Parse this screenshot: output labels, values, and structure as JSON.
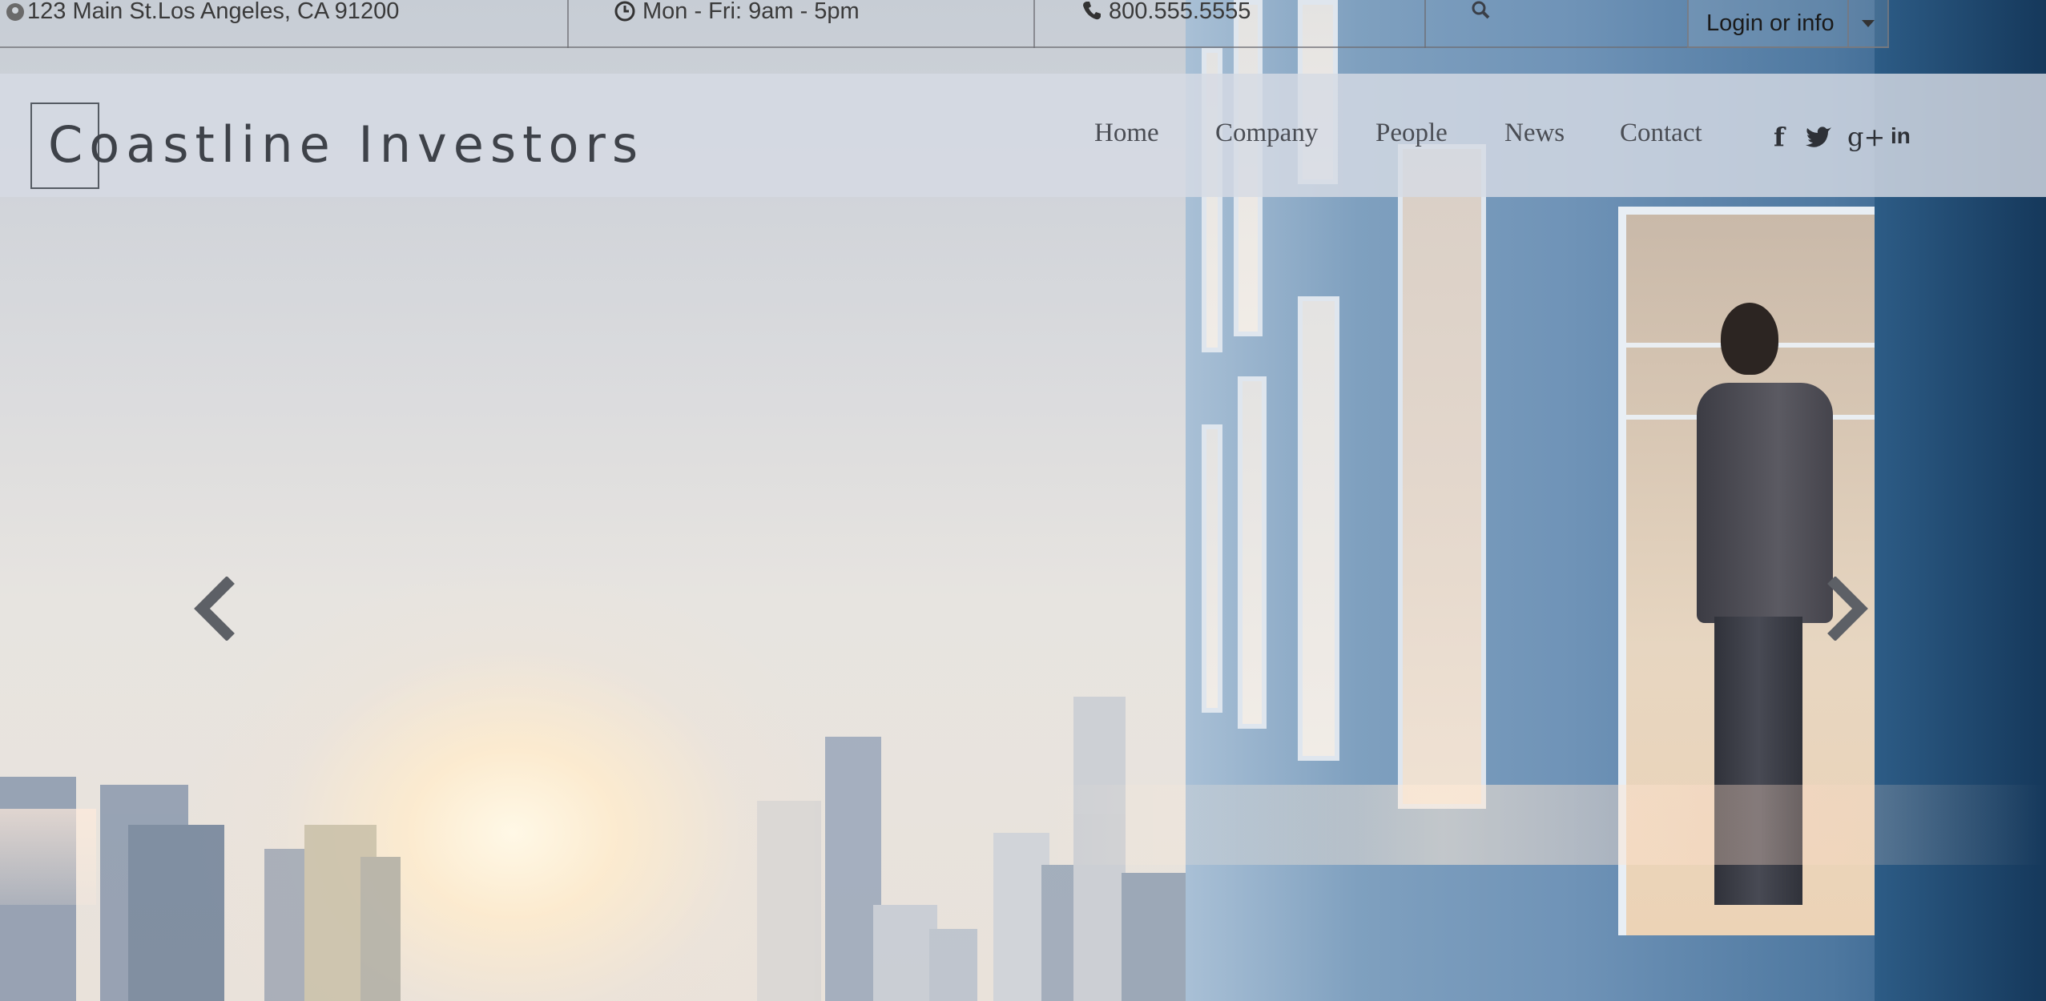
{
  "topbar": {
    "address": "123 Main St.Los Angeles, CA 91200",
    "hours": "Mon - Fri: 9am - 5pm",
    "phone": "800.555.5555",
    "login_label": "Login or info"
  },
  "header": {
    "logo_text": "Coastline Investors"
  },
  "nav": {
    "items": [
      "Home",
      "Company",
      "People",
      "News",
      "Contact"
    ]
  },
  "social": {
    "icons": [
      "facebook-icon",
      "twitter-icon",
      "google-plus-icon",
      "linkedin-icon"
    ],
    "facebook": "f",
    "twitter": "t",
    "google_plus": "g+",
    "linkedin": "in"
  },
  "colors": {
    "header_bg": "#d6dbe4",
    "text": "#3e4249",
    "wall": "#4e78a0"
  }
}
